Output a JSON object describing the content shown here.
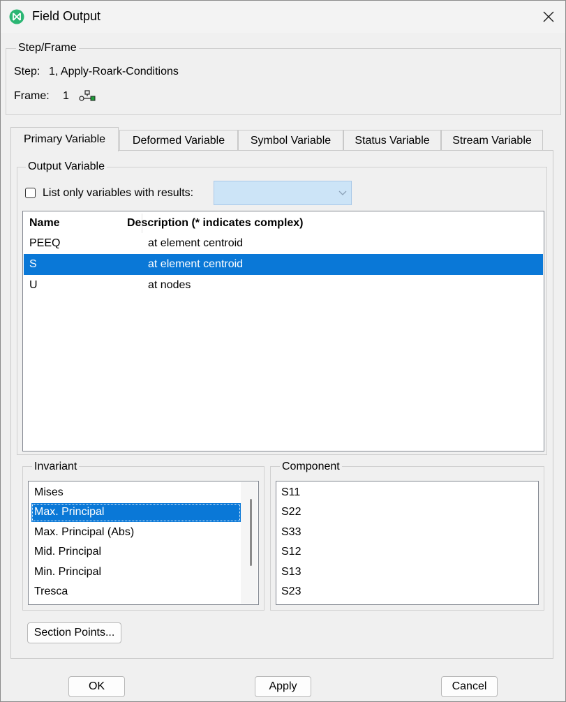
{
  "window": {
    "title": "Field Output"
  },
  "step_frame": {
    "group_label": "Step/Frame",
    "step_label": "Step:",
    "step_value": "1, Apply-Roark-Conditions",
    "frame_label": "Frame:",
    "frame_value": "1"
  },
  "tabs": [
    {
      "label": "Primary Variable",
      "active": true
    },
    {
      "label": "Deformed Variable",
      "active": false
    },
    {
      "label": "Symbol Variable",
      "active": false
    },
    {
      "label": "Status Variable",
      "active": false
    },
    {
      "label": "Stream Variable",
      "active": false
    }
  ],
  "output_variable": {
    "group_label": "Output Variable",
    "filter_checkbox_label": "List only variables with results:",
    "filter_checked": false,
    "filter_combo_value": "",
    "columns": [
      "Name",
      "Description (* indicates complex)"
    ],
    "rows": [
      {
        "name": "PEEQ",
        "description": "at element centroid",
        "selected": false
      },
      {
        "name": "S",
        "description": "at element centroid",
        "selected": true
      },
      {
        "name": "U",
        "description": "at nodes",
        "selected": false
      }
    ]
  },
  "invariant": {
    "group_label": "Invariant",
    "items": [
      "Mises",
      "Max. Principal",
      "Max. Principal (Abs)",
      "Mid. Principal",
      "Min. Principal",
      "Tresca"
    ],
    "selected_index": 1
  },
  "component": {
    "group_label": "Component",
    "items": [
      "S11",
      "S22",
      "S33",
      "S12",
      "S13",
      "S23"
    ]
  },
  "section_points_button": "Section Points...",
  "footer": {
    "ok": "OK",
    "apply": "Apply",
    "cancel": "Cancel"
  },
  "colors": {
    "selection": "#0a78d7",
    "accent_icon": "#2bb673"
  }
}
